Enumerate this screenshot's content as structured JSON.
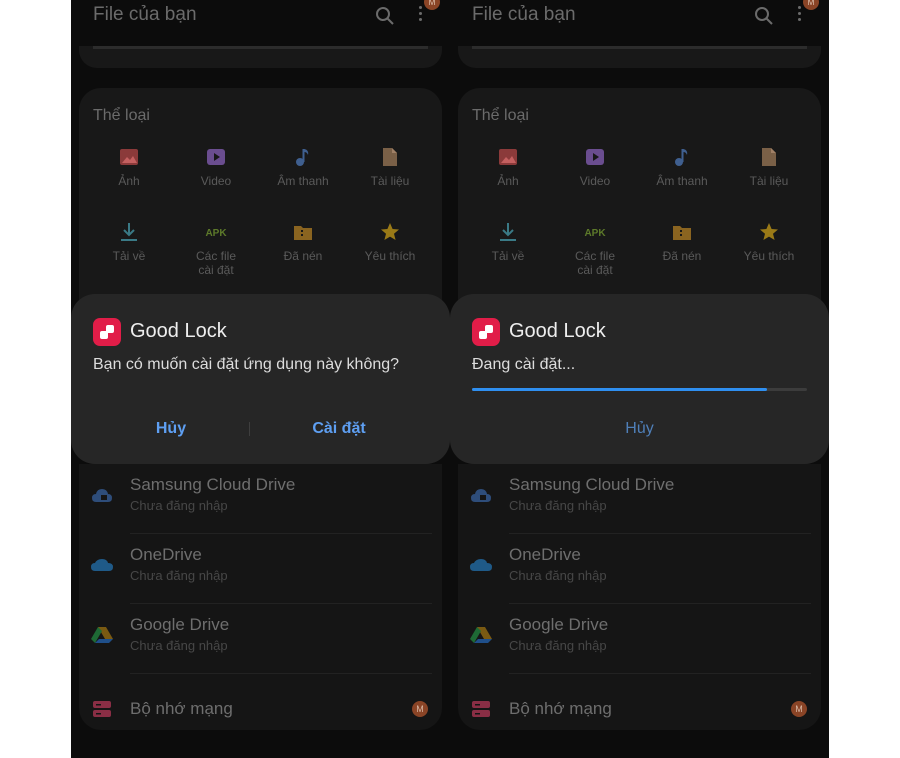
{
  "appbar": {
    "title": "File của bạn",
    "badge": "M"
  },
  "categories": {
    "title": "Thể loại",
    "items": [
      {
        "label": "Ảnh",
        "icon": "image-icon",
        "color": "#8b3a3a"
      },
      {
        "label": "Video",
        "icon": "video-icon",
        "color": "#6a4d8f"
      },
      {
        "label": "Âm thanh",
        "icon": "music-icon",
        "color": "#3f5f8f"
      },
      {
        "label": "Tài liệu",
        "icon": "document-icon",
        "color": "#7a6047"
      },
      {
        "label": "Tải về",
        "icon": "download-icon",
        "color": "#3a7a86"
      },
      {
        "label": "Các file\ncài đặt",
        "icon": "apk-icon",
        "color": "#5d7a2a"
      },
      {
        "label": "Đã nén",
        "icon": "archive-icon",
        "color": "#8a6420"
      },
      {
        "label": "Yêu thích",
        "icon": "star-icon",
        "color": "#9a7a17"
      }
    ]
  },
  "dialog_left": {
    "title": "Good Lock",
    "message": "Bạn có muốn cài đặt ứng dụng này không?",
    "cancel": "Hủy",
    "install": "Cài đặt"
  },
  "dialog_right": {
    "title": "Good Lock",
    "message": "Đang cài đặt...",
    "progress": 0.88,
    "cancel": "Hủy"
  },
  "storage": [
    {
      "title": "Samsung Cloud Drive",
      "subtitle": "Chưa đăng nhập",
      "icon": "samsung-cloud-icon"
    },
    {
      "title": "OneDrive",
      "subtitle": "Chưa đăng nhập",
      "icon": "onedrive-icon"
    },
    {
      "title": "Google Drive",
      "subtitle": "Chưa đăng nhập",
      "icon": "google-drive-icon"
    },
    {
      "title": "Bộ nhớ mạng",
      "subtitle": "",
      "icon": "network-storage-icon",
      "badge": "M"
    }
  ],
  "colors": {
    "accent": "#5e9ff2",
    "progress": "#2f8ff0",
    "brand_goodlock": "#e11d48"
  }
}
